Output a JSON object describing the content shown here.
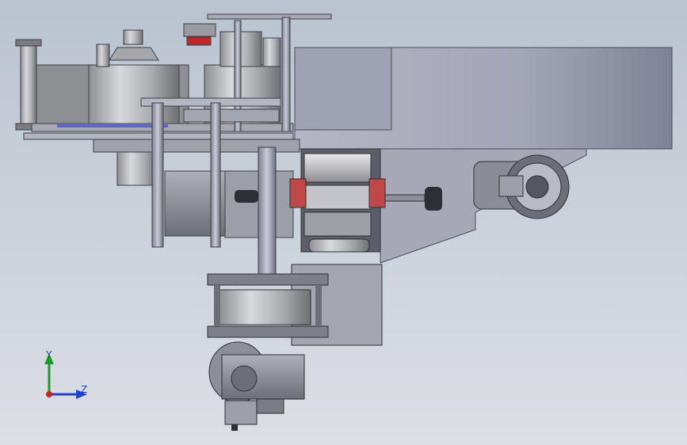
{
  "viewport": {
    "background_top": "#b9c3d0",
    "background_bottom": "#dcdfe4"
  },
  "model": {
    "description_icon": "cad-assembly-icon"
  },
  "triad": {
    "y_label": "Y",
    "z_label": "Z",
    "y_color": "#1a9a2a",
    "z_color": "#2244cc",
    "origin_color": "#cc2222"
  }
}
